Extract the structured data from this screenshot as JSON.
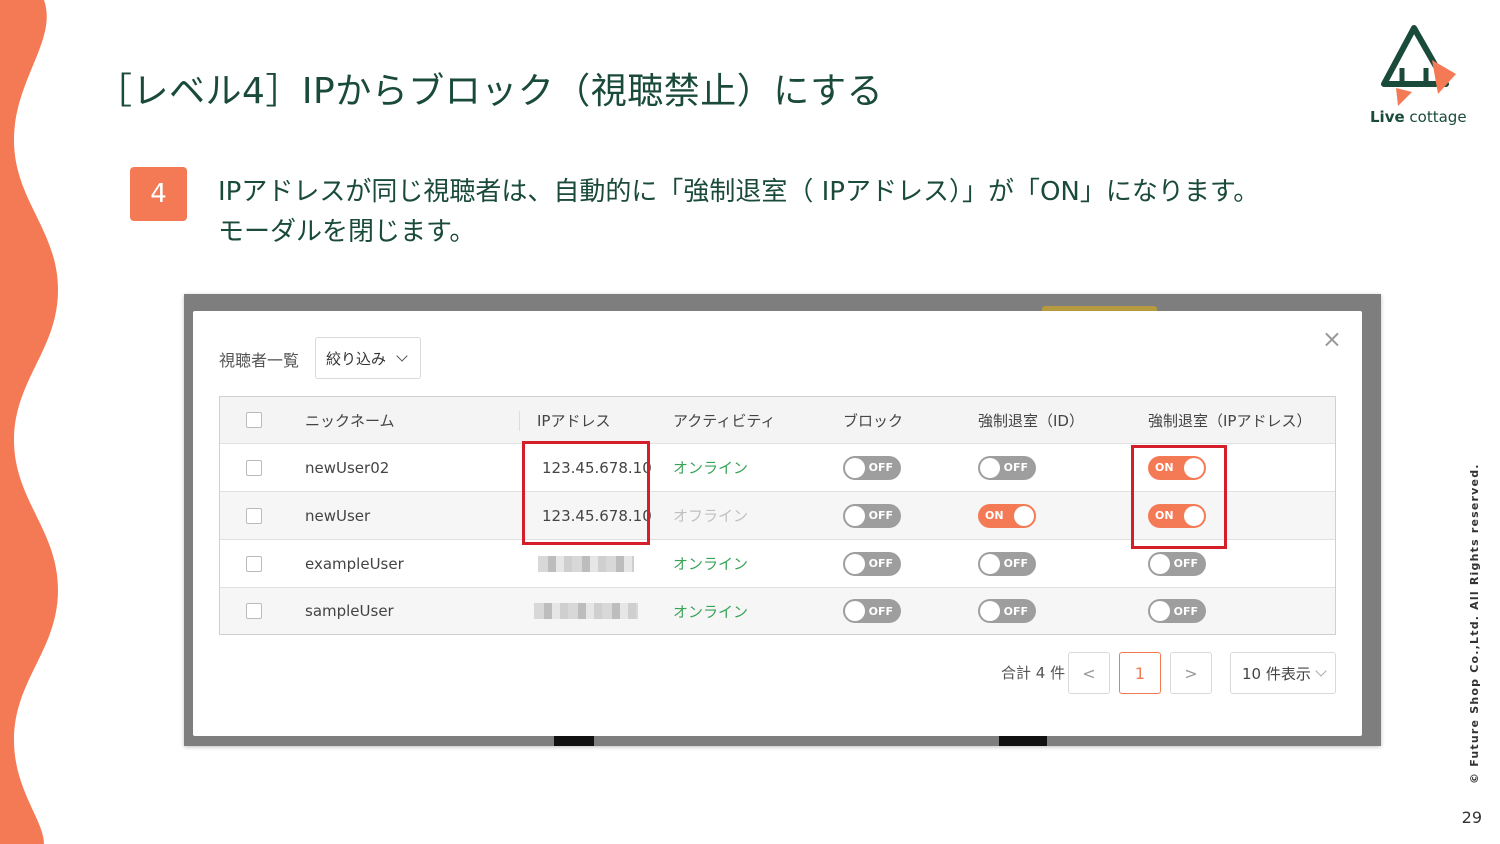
{
  "slide": {
    "title": "［レベル4］IPからブロック（視聴禁止）にする",
    "logo_text_bold": "Live",
    "logo_text_rest": " cottage",
    "step_number": "4",
    "step_line1": "IPアドレスが同じ視聴者は、自動的に「強制退室（ IPアドレス）」が「ON」になります。",
    "step_line2": "モーダルを閉じます。",
    "copyright": "© Future Shop Co.,Ltd. All Rights reserved.",
    "page_number": "29"
  },
  "colors": {
    "accent": "#f47a55",
    "title_green": "#1a4a3a",
    "online_green": "#3aa35a",
    "highlight_red": "#d41f2a",
    "toggle_off": "#9e9e9e"
  },
  "modal": {
    "label": "視聴者一覧",
    "filter_label": "絞り込み",
    "close_symbol": "×",
    "columns": {
      "nickname": "ニックネーム",
      "ip": "IPアドレス",
      "activity": "アクティビティ",
      "block": "ブロック",
      "kick_id": "強制退室（ID）",
      "kick_ip": "強制退室（IPアドレス）"
    },
    "rows": [
      {
        "nickname": "newUser02",
        "ip": "123.45.678.10",
        "activity": "オンライン",
        "block": "OFF",
        "kick_id": "OFF",
        "kick_ip": "ON"
      },
      {
        "nickname": "newUser",
        "ip": "123.45.678.10",
        "activity": "オフライン",
        "block": "OFF",
        "kick_id": "ON",
        "kick_ip": "ON"
      },
      {
        "nickname": "exampleUser",
        "ip": "",
        "activity": "オンライン",
        "block": "OFF",
        "kick_id": "OFF",
        "kick_ip": "OFF"
      },
      {
        "nickname": "sampleUser",
        "ip": "",
        "activity": "オンライン",
        "block": "OFF",
        "kick_id": "OFF",
        "kick_ip": "OFF"
      }
    ],
    "pagination": {
      "total": "合計 4 件",
      "prev": "<",
      "current": "1",
      "next": ">",
      "per_page": "10 件表示"
    }
  }
}
